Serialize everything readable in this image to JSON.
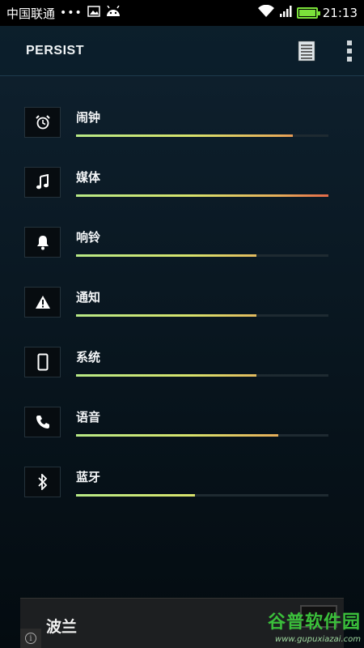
{
  "status_bar": {
    "carrier": "中国联通",
    "dots": "•••",
    "time": "21:13",
    "battery_color": "#7be23a"
  },
  "action_bar": {
    "title": "PERSIST",
    "list_icon": "list-icon",
    "overflow_icon": "overflow-menu-icon"
  },
  "volumes": [
    {
      "label": "闹钟",
      "icon": "alarm-icon",
      "level": 0.86
    },
    {
      "label": "媒体",
      "icon": "music-note-icon",
      "level": 1.0
    },
    {
      "label": "响铃",
      "icon": "bell-icon",
      "level": 0.715
    },
    {
      "label": "通知",
      "icon": "warning-icon",
      "level": 0.715
    },
    {
      "label": "系统",
      "icon": "phone-device-icon",
      "level": 0.715
    },
    {
      "label": "语音",
      "icon": "phone-handset-icon",
      "level": 0.8
    },
    {
      "label": "蓝牙",
      "icon": "bluetooth-icon",
      "level": 0.47
    }
  ],
  "toast": {
    "text": "波兰"
  },
  "watermark": {
    "main": "谷普软件园",
    "sub": "www.gupuxiazai.com"
  },
  "colors": {
    "background": "#0b1a25",
    "bar_start": "#b8e986",
    "bar_end": "#e56a48"
  }
}
